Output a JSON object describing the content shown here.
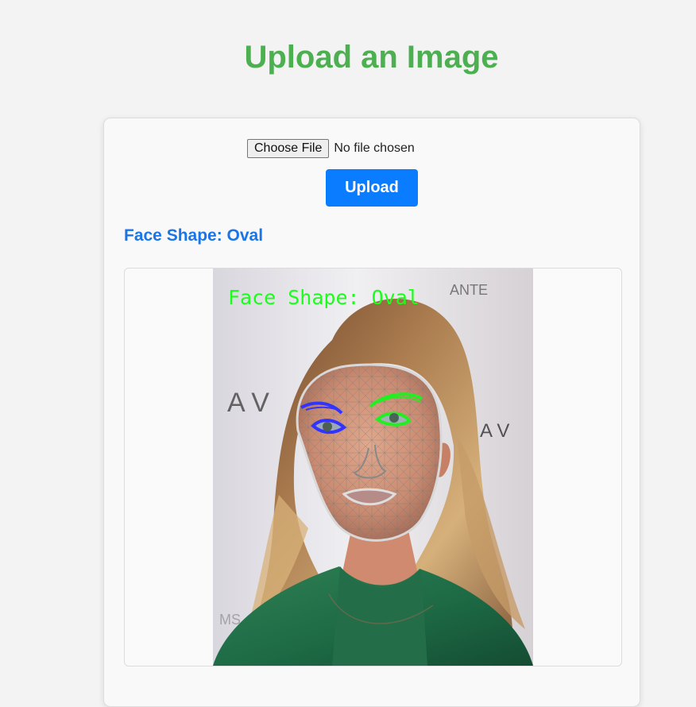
{
  "page": {
    "title": "Upload an Image"
  },
  "form": {
    "choose_file_label": "Choose File",
    "file_status": "No file chosen",
    "upload_label": "Upload"
  },
  "result": {
    "face_shape_text": "Face Shape: Oval",
    "overlay_text": "Face Shape: Oval"
  },
  "colors": {
    "title": "#4caf50",
    "button": "#0a7cff",
    "result_text": "#1b75e6",
    "left_eye_overlay": "#3333ff",
    "right_eye_overlay": "#22ee22",
    "overlay_text": "#18ff18"
  }
}
